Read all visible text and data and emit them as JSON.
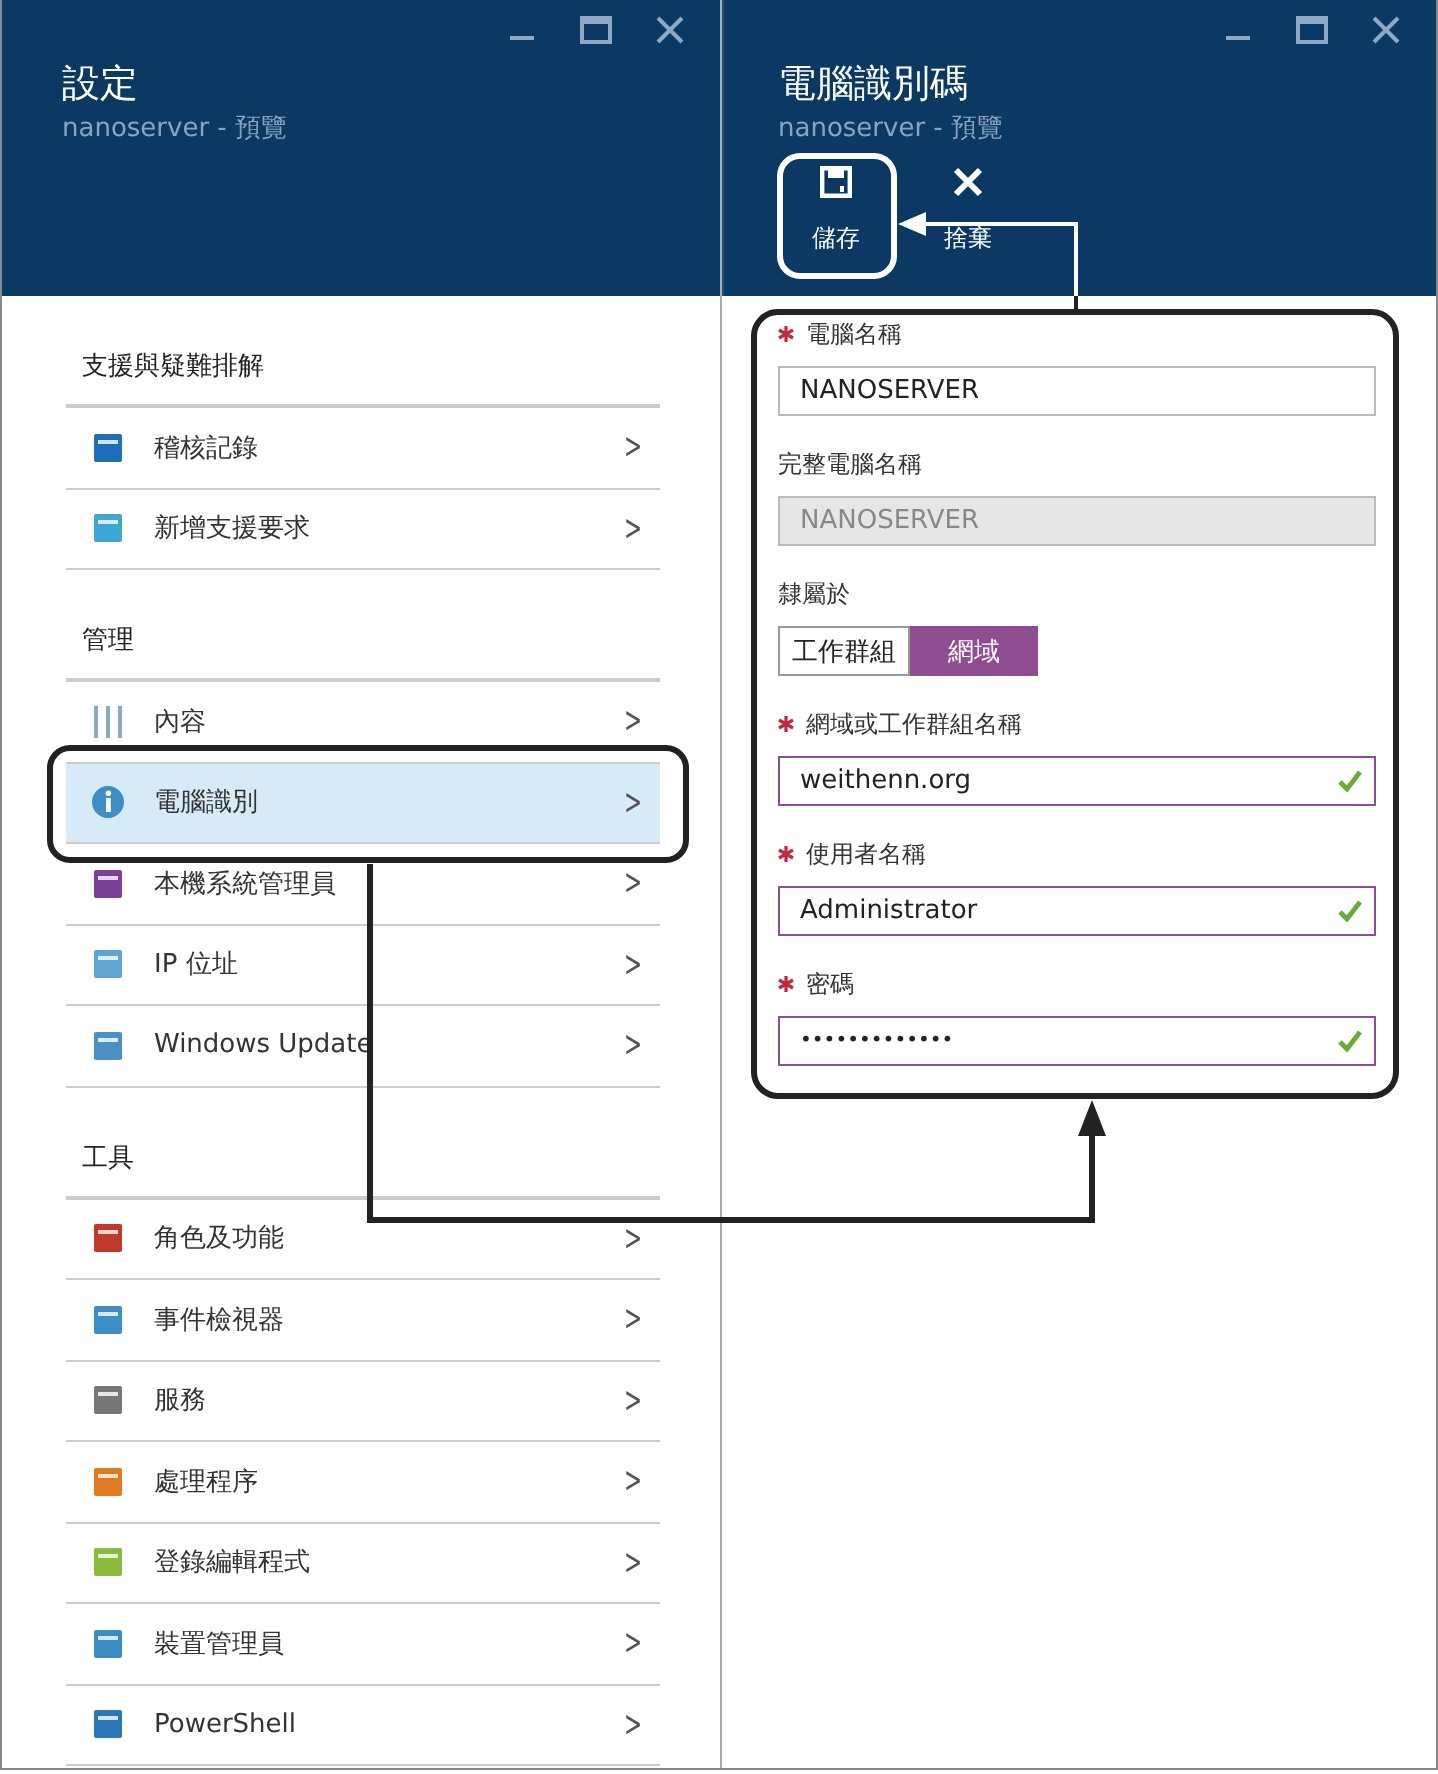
{
  "left_blade": {
    "title": "設定",
    "subtitle": "nanoserver - 預覽",
    "sections": [
      {
        "heading": "支援與疑難排解",
        "items": [
          {
            "label": "稽核記錄",
            "chevron": ">",
            "selected": false
          },
          {
            "label": "新增支援要求",
            "chevron": ">",
            "selected": false
          }
        ]
      },
      {
        "heading": "管理",
        "items": [
          {
            "label": "內容",
            "chevron": ">",
            "selected": false
          },
          {
            "label": "電腦識別",
            "chevron": ">",
            "selected": true
          },
          {
            "label": "本機系統管理員",
            "chevron": ">",
            "selected": false
          },
          {
            "label": "IP 位址",
            "chevron": ">",
            "selected": false
          },
          {
            "label": "Windows Update",
            "chevron": ">",
            "selected": false
          }
        ]
      },
      {
        "heading": "工具",
        "items": [
          {
            "label": "角色及功能",
            "chevron": ">",
            "selected": false
          },
          {
            "label": "事件檢視器",
            "chevron": ">",
            "selected": false
          },
          {
            "label": "服務",
            "chevron": ">",
            "selected": false
          },
          {
            "label": "處理程序",
            "chevron": ">",
            "selected": false
          },
          {
            "label": "登錄編輯程式",
            "chevron": ">",
            "selected": false
          },
          {
            "label": "裝置管理員",
            "chevron": ">",
            "selected": false
          },
          {
            "label": "PowerShell",
            "chevron": ">",
            "selected": false
          }
        ]
      }
    ]
  },
  "right_blade": {
    "title": "電腦識別碼",
    "subtitle": "nanoserver - 預覽",
    "commands": [
      {
        "kind": "save",
        "label": "儲存"
      },
      {
        "kind": "discard",
        "label": "捨棄"
      }
    ],
    "fields": [
      {
        "kind": "text",
        "label": "電腦名稱",
        "required": true,
        "value": "NANOSERVER",
        "valid": false
      },
      {
        "kind": "disabled",
        "label": "完整電腦名稱",
        "required": false,
        "value": "NANOSERVER",
        "valid": false
      },
      {
        "kind": "toggle",
        "label": "隸屬於",
        "required": false,
        "options": [
          {
            "label": "工作群組",
            "selected": false
          },
          {
            "label": "網域",
            "selected": true
          }
        ]
      },
      {
        "kind": "text",
        "label": "網域或工作群組名稱",
        "required": true,
        "value": "weithenn.org",
        "valid": true
      },
      {
        "kind": "text",
        "label": "使用者名稱",
        "required": true,
        "value": "Administrator",
        "valid": true
      },
      {
        "kind": "password",
        "label": "密碼",
        "required": true,
        "value": "•••••••••••••",
        "valid": true
      }
    ]
  }
}
